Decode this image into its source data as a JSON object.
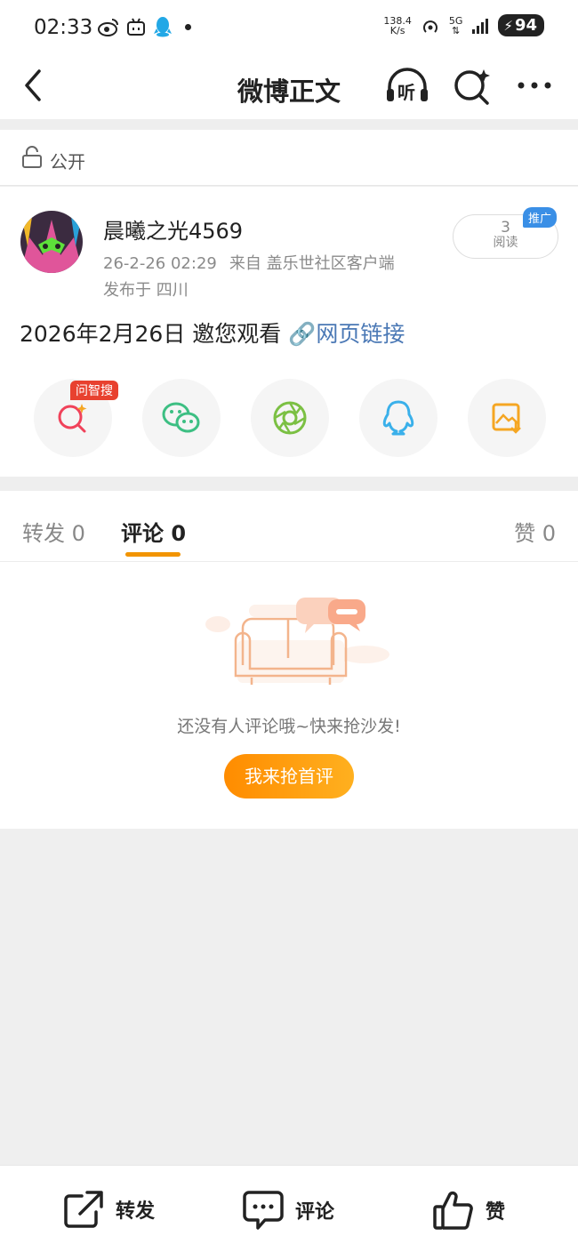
{
  "status_bar": {
    "time": "02:33",
    "net_speed_value": "138.4",
    "net_speed_unit": "K/s",
    "network": "5G",
    "battery": "94"
  },
  "nav": {
    "title": "微博正文",
    "listen_label": "听"
  },
  "visibility": {
    "label": "公开"
  },
  "post": {
    "author": "晨曦之光4569",
    "time": "26-2-26 02:29",
    "source": "来自 盖乐世社区客户端",
    "location": "发布于 四川",
    "reads_count": "3",
    "reads_label": "阅读",
    "promo_badge": "推广",
    "text": "2026年2月26日 邀您观看 ",
    "link_text": "网页链接"
  },
  "share": {
    "badge": "问智搜",
    "items": [
      {
        "name": "search",
        "icon": "ai-search-icon",
        "color": "#f0425a"
      },
      {
        "name": "wechat",
        "icon": "wechat-icon",
        "color": "#3dbf83"
      },
      {
        "name": "moments",
        "icon": "moments-icon",
        "color": "#7bc043"
      },
      {
        "name": "qq",
        "icon": "qq-icon",
        "color": "#3ab0ea"
      },
      {
        "name": "save-image",
        "icon": "save-image-icon",
        "color": "#f5a623"
      }
    ]
  },
  "tabs": {
    "repost": "转发 0",
    "comment": "评论 0",
    "like": "赞 0"
  },
  "empty_state": {
    "message": "还没有人评论哦~快来抢沙发!",
    "cta": "我来抢首评"
  },
  "bottom_bar": {
    "repost": "转发",
    "comment": "评论",
    "like": "赞"
  },
  "colors": {
    "accent": "#f29400",
    "link": "#4a78b5"
  }
}
